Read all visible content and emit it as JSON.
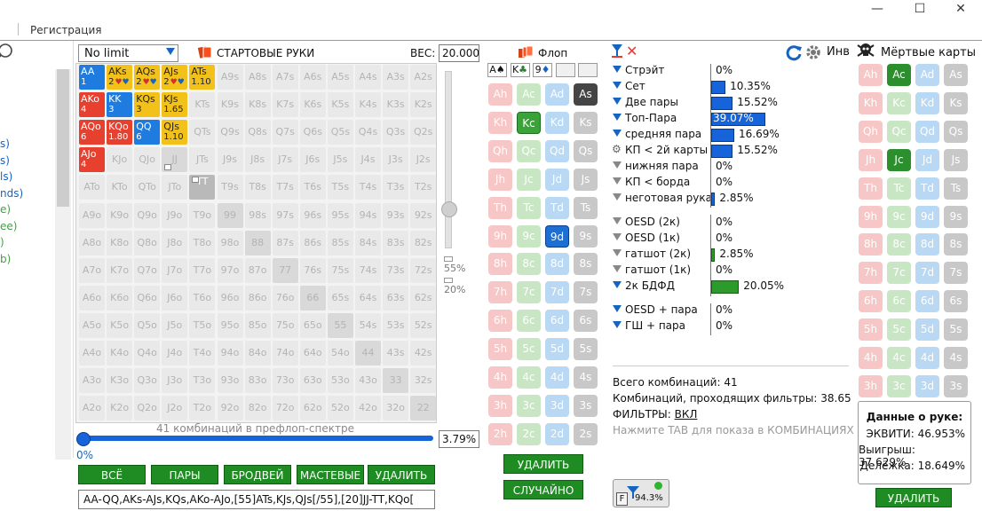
{
  "window": {
    "menu_item": "Регистрация",
    "minimize": "—",
    "maximize": "☐",
    "close": "✕"
  },
  "sidebar": {
    "items": [
      {
        "text": "s)",
        "color": "#1565c0"
      },
      {
        "text": "s)",
        "color": "#1565c0"
      },
      {
        "text": "ls)",
        "color": "#1565c0"
      },
      {
        "text": "nds)",
        "color": "#1565c0"
      },
      {
        "text": "e)",
        "color": "#43a047"
      },
      {
        "text": "ee)",
        "color": "#43a047"
      },
      {
        "text": ")",
        "color": "#43a047"
      },
      {
        "text": "b)",
        "color": "#43a047"
      }
    ]
  },
  "preflop": {
    "limit": "No limit",
    "title": "СТАРТОВЫЕ РУКИ",
    "weight_label": "ВЕС:",
    "weight_value": "20.000",
    "slider_top_pct": "55%",
    "slider_bottom_pct": "20%",
    "combo_text": "41 комбинаций в префлоп-спектре",
    "progress_pct": "0%",
    "progress_value": "3.79%",
    "buttons": [
      "ВСЁ",
      "ПАРЫ",
      "БРОДВЕЙ",
      "МАСТЕВЫЕ",
      "УДАЛИТЬ"
    ],
    "range_text": "AA-QQ,AKs-AJs,KQs,AKo-AJo,[55]ATs,KJs,QJs[/55],[20]JJ-TT,KQo["
  },
  "grid": [
    [
      {
        "t": "AA",
        "w": "1",
        "s": "blue"
      },
      {
        "t": "AKs",
        "w": "2",
        "s": "yellow",
        "hearts": true
      },
      {
        "t": "AQs",
        "w": "2",
        "s": "yellow",
        "hearts": true
      },
      {
        "t": "AJs",
        "w": "2",
        "s": "yellow",
        "hearts": true
      },
      {
        "t": "ATs",
        "w": "1.10",
        "s": "yellow"
      },
      {
        "t": "A9s"
      },
      {
        "t": "A8s"
      },
      {
        "t": "A7s"
      },
      {
        "t": "A6s"
      },
      {
        "t": "A5s"
      },
      {
        "t": "A4s"
      },
      {
        "t": "A3s"
      },
      {
        "t": "A2s"
      }
    ],
    [
      {
        "t": "AKo",
        "w": "4",
        "s": "red"
      },
      {
        "t": "KK",
        "w": "3",
        "s": "blue"
      },
      {
        "t": "KQs",
        "w": "3",
        "s": "yellow"
      },
      {
        "t": "KJs",
        "w": "1.65",
        "s": "yellow"
      },
      {
        "t": "KTs"
      },
      {
        "t": "K9s"
      },
      {
        "t": "K8s"
      },
      {
        "t": "K7s"
      },
      {
        "t": "K6s"
      },
      {
        "t": "K5s"
      },
      {
        "t": "K4s"
      },
      {
        "t": "K3s"
      },
      {
        "t": "K2s"
      }
    ],
    [
      {
        "t": "AQo",
        "w": "6",
        "s": "red"
      },
      {
        "t": "KQo",
        "w": "1.80",
        "s": "red"
      },
      {
        "t": "QQ",
        "w": "6",
        "s": "blue"
      },
      {
        "t": "QJs",
        "w": "1.10",
        "s": "yellow"
      },
      {
        "t": "QTs"
      },
      {
        "t": "Q9s"
      },
      {
        "t": "Q8s"
      },
      {
        "t": "Q7s"
      },
      {
        "t": "Q6s"
      },
      {
        "t": "Q5s"
      },
      {
        "t": "Q4s"
      },
      {
        "t": "Q3s"
      },
      {
        "t": "Q2s"
      }
    ],
    [
      {
        "t": "AJo",
        "w": "4",
        "s": "red"
      },
      {
        "t": "KJo"
      },
      {
        "t": "QJo"
      },
      {
        "t": "JJ",
        "s": "pair"
      },
      {
        "t": "JTs"
      },
      {
        "t": "J9s"
      },
      {
        "t": "J8s"
      },
      {
        "t": "J7s"
      },
      {
        "t": "J6s"
      },
      {
        "t": "J5s"
      },
      {
        "t": "J4s"
      },
      {
        "t": "J3s"
      },
      {
        "t": "J2s"
      }
    ],
    [
      {
        "t": "ATo"
      },
      {
        "t": "KTo"
      },
      {
        "t": "QTo"
      },
      {
        "t": "JTo"
      },
      {
        "t": "TT",
        "s": "grey"
      },
      {
        "t": "T9s"
      },
      {
        "t": "T8s"
      },
      {
        "t": "T7s"
      },
      {
        "t": "T6s"
      },
      {
        "t": "T5s"
      },
      {
        "t": "T4s"
      },
      {
        "t": "T3s"
      },
      {
        "t": "T2s"
      }
    ],
    [
      {
        "t": "A9o"
      },
      {
        "t": "K9o"
      },
      {
        "t": "Q9o"
      },
      {
        "t": "J9o"
      },
      {
        "t": "T9o"
      },
      {
        "t": "99",
        "s": "pair"
      },
      {
        "t": "98s"
      },
      {
        "t": "97s"
      },
      {
        "t": "96s"
      },
      {
        "t": "95s"
      },
      {
        "t": "94s"
      },
      {
        "t": "93s"
      },
      {
        "t": "92s"
      }
    ],
    [
      {
        "t": "A8o"
      },
      {
        "t": "K8o"
      },
      {
        "t": "Q8o"
      },
      {
        "t": "J8o"
      },
      {
        "t": "T8o"
      },
      {
        "t": "98o"
      },
      {
        "t": "88",
        "s": "pair"
      },
      {
        "t": "87s"
      },
      {
        "t": "86s"
      },
      {
        "t": "85s"
      },
      {
        "t": "84s"
      },
      {
        "t": "83s"
      },
      {
        "t": "82s"
      }
    ],
    [
      {
        "t": "A7o"
      },
      {
        "t": "K7o"
      },
      {
        "t": "Q7o"
      },
      {
        "t": "J7o"
      },
      {
        "t": "T7o"
      },
      {
        "t": "97o"
      },
      {
        "t": "87o"
      },
      {
        "t": "77",
        "s": "pair"
      },
      {
        "t": "76s"
      },
      {
        "t": "75s"
      },
      {
        "t": "74s"
      },
      {
        "t": "73s"
      },
      {
        "t": "72s"
      }
    ],
    [
      {
        "t": "A6o"
      },
      {
        "t": "K6o"
      },
      {
        "t": "Q6o"
      },
      {
        "t": "J6o"
      },
      {
        "t": "T6o"
      },
      {
        "t": "96o"
      },
      {
        "t": "86o"
      },
      {
        "t": "76o"
      },
      {
        "t": "66",
        "s": "pair"
      },
      {
        "t": "65s"
      },
      {
        "t": "64s"
      },
      {
        "t": "63s"
      },
      {
        "t": "62s"
      }
    ],
    [
      {
        "t": "A5o"
      },
      {
        "t": "K5o"
      },
      {
        "t": "Q5o"
      },
      {
        "t": "J5o"
      },
      {
        "t": "T5o"
      },
      {
        "t": "95o"
      },
      {
        "t": "85o"
      },
      {
        "t": "75o"
      },
      {
        "t": "65o"
      },
      {
        "t": "55",
        "s": "pair"
      },
      {
        "t": "54s"
      },
      {
        "t": "53s"
      },
      {
        "t": "52s"
      }
    ],
    [
      {
        "t": "A4o"
      },
      {
        "t": "K4o"
      },
      {
        "t": "Q4o"
      },
      {
        "t": "J4o"
      },
      {
        "t": "T4o"
      },
      {
        "t": "94o"
      },
      {
        "t": "84o"
      },
      {
        "t": "74o"
      },
      {
        "t": "64o"
      },
      {
        "t": "54o"
      },
      {
        "t": "44",
        "s": "pair"
      },
      {
        "t": "43s"
      },
      {
        "t": "42s"
      }
    ],
    [
      {
        "t": "A3o"
      },
      {
        "t": "K3o"
      },
      {
        "t": "Q3o"
      },
      {
        "t": "J3o"
      },
      {
        "t": "T3o"
      },
      {
        "t": "93o"
      },
      {
        "t": "83o"
      },
      {
        "t": "73o"
      },
      {
        "t": "63o"
      },
      {
        "t": "53o"
      },
      {
        "t": "43o"
      },
      {
        "t": "33",
        "s": "pair"
      },
      {
        "t": "32s"
      }
    ],
    [
      {
        "t": "A2o"
      },
      {
        "t": "K2o"
      },
      {
        "t": "Q2o"
      },
      {
        "t": "J2o"
      },
      {
        "t": "T2o"
      },
      {
        "t": "92o"
      },
      {
        "t": "82o"
      },
      {
        "t": "72o"
      },
      {
        "t": "62o"
      },
      {
        "t": "52o"
      },
      {
        "t": "42o"
      },
      {
        "t": "32o"
      },
      {
        "t": "22",
        "s": "pair"
      }
    ]
  ],
  "flop": {
    "title": "Флоп",
    "slots": [
      {
        "rank": "A",
        "suit": "♠"
      },
      {
        "rank": "K",
        "suit": "♣"
      },
      {
        "rank": "9",
        "suit": "♦"
      }
    ],
    "ranks": [
      "A",
      "K",
      "Q",
      "J",
      "T",
      "9",
      "8",
      "7",
      "6",
      "5",
      "4",
      "3",
      "2"
    ],
    "selected": {
      "A": "s",
      "K": "c",
      "9": "d"
    },
    "delete_button": "УДАЛИТЬ",
    "random_button": "СЛУЧАЙНО"
  },
  "filters": {
    "info_label": "Инв",
    "rows": [
      {
        "label": "Стрэйт",
        "value": "0%",
        "pct": 0,
        "icon": "blue"
      },
      {
        "label": "Сет",
        "value": "10.35%",
        "pct": 10.35,
        "icon": "blue"
      },
      {
        "label": "Две пары",
        "value": "15.52%",
        "pct": 15.52,
        "icon": "blue"
      },
      {
        "label": "Топ-Пара",
        "value": "39.07%",
        "pct": 39.07,
        "icon": "blue"
      },
      {
        "label": "средняя пара",
        "value": "16.69%",
        "pct": 16.69,
        "icon": "blue"
      },
      {
        "label": "КП < 2й карты",
        "value": "15.52%",
        "pct": 15.52,
        "icon": "gear"
      },
      {
        "label": "нижняя пара",
        "value": "0%",
        "pct": 0,
        "icon": "grey"
      },
      {
        "label": "КП < борда",
        "value": "0%",
        "pct": 0,
        "icon": "grey"
      },
      {
        "label": "неготовая рука",
        "value": "2.85%",
        "pct": 2.85,
        "icon": "grey"
      },
      {
        "label": "OESD (2к)",
        "value": "0%",
        "pct": 0,
        "icon": "grey",
        "gap": true
      },
      {
        "label": "OESD (1к)",
        "value": "0%",
        "pct": 0,
        "icon": "grey"
      },
      {
        "label": "гатшот (2к)",
        "value": "2.85%",
        "pct": 2.85,
        "icon": "grey",
        "green": true
      },
      {
        "label": "гатшот (1к)",
        "value": "0%",
        "pct": 0,
        "icon": "grey"
      },
      {
        "label": "2к БДФД",
        "value": "20.05%",
        "pct": 20.05,
        "icon": "blue",
        "green": true
      },
      {
        "label": "OESD + пара",
        "value": "0%",
        "pct": 0,
        "icon": "blue",
        "gap": true
      },
      {
        "label": "ГШ + пара",
        "value": "0%",
        "pct": 0,
        "icon": "blue"
      }
    ],
    "total": "Всего комбинаций: 41",
    "passing": "Комбинаций, проходящих фильтры: 38.65",
    "filters_label": "ФИЛЬТРЫ:",
    "filters_state": "ВКЛ",
    "hint": "Нажмите TAB для показа в КОМБИНАЦИЯХ",
    "badge_letter": "F",
    "badge_value": "94.3%"
  },
  "dead": {
    "title": "Мёртвые карты",
    "selected": {
      "A": "c",
      "J": "c"
    },
    "delete_button": "УДАЛИТЬ"
  },
  "hand_data": {
    "title": "Данные о руке:",
    "equity": "ЭКВИТИ: 46.953%",
    "win": "Выигрыш: 37.629%",
    "tie": "Делёжка: 18.649%"
  }
}
